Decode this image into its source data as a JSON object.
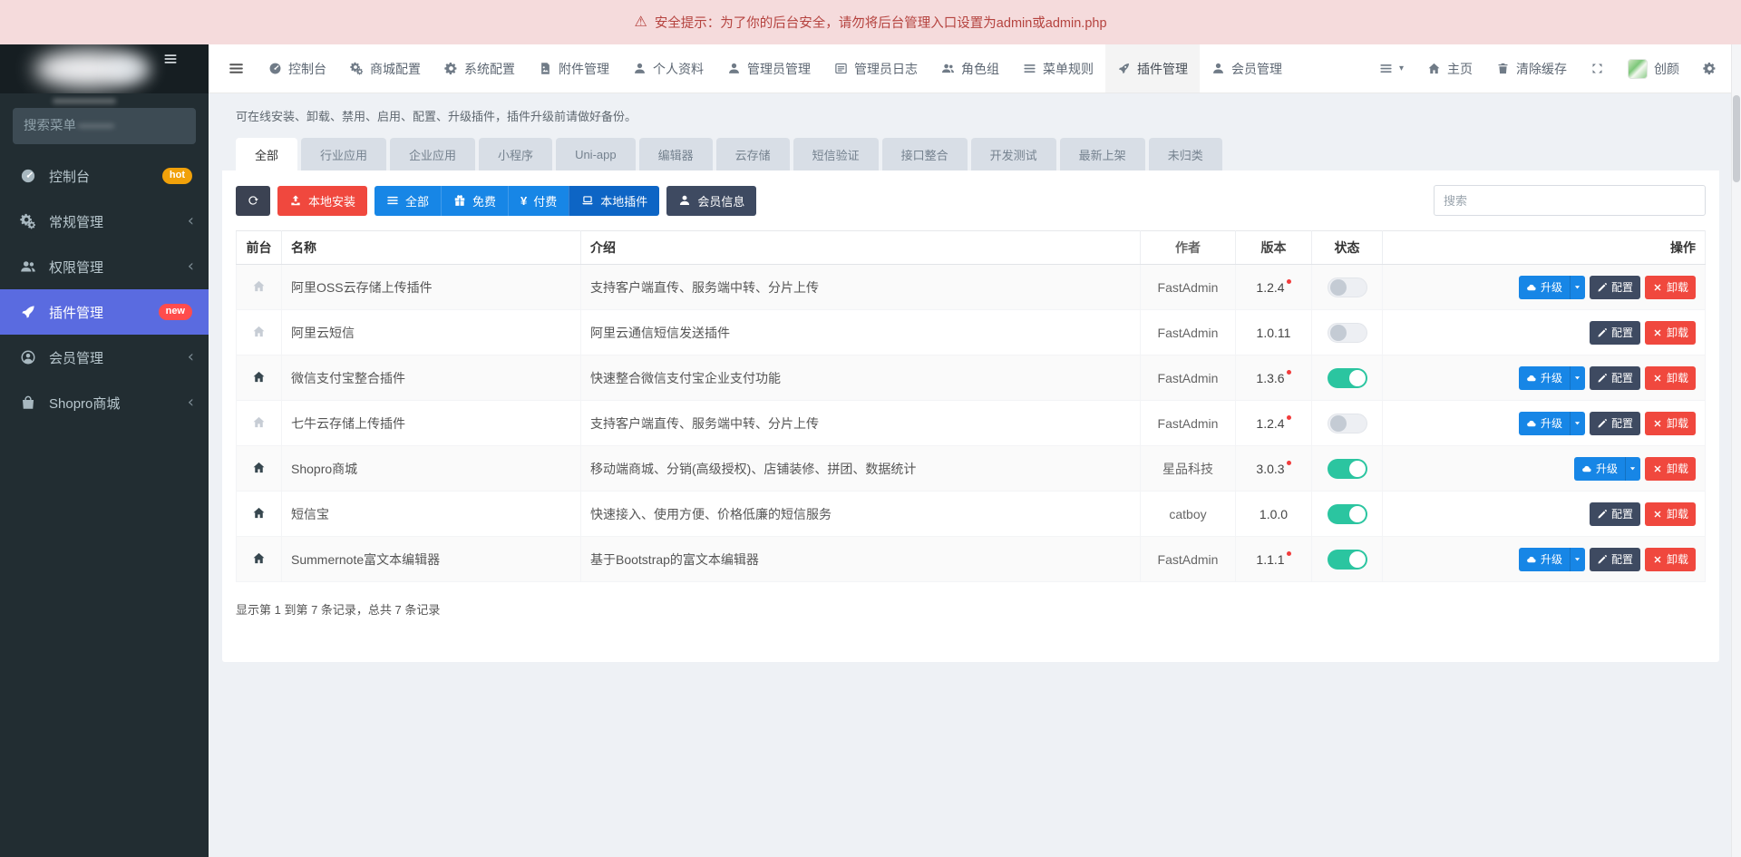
{
  "warning_bar": {
    "text": "安全提示：为了你的后台安全，请勿将后台管理入口设置为admin或admin.php"
  },
  "topnav": {
    "items": [
      {
        "key": "dashboard",
        "label": "控制台",
        "icon": "gauge-icon"
      },
      {
        "key": "shop-config",
        "label": "商城配置",
        "icon": "cogs-icon"
      },
      {
        "key": "system-config",
        "label": "系统配置",
        "icon": "gear-icon"
      },
      {
        "key": "attachment",
        "label": "附件管理",
        "icon": "file-image-icon"
      },
      {
        "key": "profile",
        "label": "个人资料",
        "icon": "user-icon"
      },
      {
        "key": "admin",
        "label": "管理员管理",
        "icon": "user-icon"
      },
      {
        "key": "admin-log",
        "label": "管理员日志",
        "icon": "log-icon"
      },
      {
        "key": "group",
        "label": "角色组",
        "icon": "users-icon"
      },
      {
        "key": "menu-rule",
        "label": "菜单规则",
        "icon": "list-icon"
      },
      {
        "key": "addon",
        "label": "插件管理",
        "icon": "rocket-icon",
        "active": true
      },
      {
        "key": "user",
        "label": "会员管理",
        "icon": "user-icon"
      }
    ],
    "home_label": "主页",
    "clear_cache_label": "清除缓存",
    "username": "创颜"
  },
  "sidebar": {
    "search_placeholder": "搜索菜单",
    "items": [
      {
        "key": "dashboard",
        "label": "控制台",
        "icon": "gauge-icon",
        "badge": "hot"
      },
      {
        "key": "general",
        "label": "常规管理",
        "icon": "cogs-icon",
        "chevron": true
      },
      {
        "key": "auth",
        "label": "权限管理",
        "icon": "users-icon",
        "chevron": true
      },
      {
        "key": "addon",
        "label": "插件管理",
        "icon": "rocket-icon",
        "badge": "new",
        "active": true
      },
      {
        "key": "user",
        "label": "会员管理",
        "icon": "user-circle-icon",
        "chevron": true
      },
      {
        "key": "shopro",
        "label": "Shopro商城",
        "icon": "shop-icon",
        "chevron": true
      }
    ]
  },
  "page": {
    "description": "可在线安装、卸载、禁用、启用、配置、升级插件，插件升级前请做好备份。",
    "tabs": [
      {
        "key": "all",
        "label": "全部",
        "active": true
      },
      {
        "key": "industry",
        "label": "行业应用"
      },
      {
        "key": "enterprise",
        "label": "企业应用"
      },
      {
        "key": "miniapp",
        "label": "小程序"
      },
      {
        "key": "uniapp",
        "label": "Uni-app"
      },
      {
        "key": "editor",
        "label": "编辑器"
      },
      {
        "key": "cloud-storage",
        "label": "云存储"
      },
      {
        "key": "sms",
        "label": "短信验证"
      },
      {
        "key": "api",
        "label": "接口整合"
      },
      {
        "key": "devtest",
        "label": "开发测试"
      },
      {
        "key": "newest",
        "label": "最新上架"
      },
      {
        "key": "uncategorized",
        "label": "未归类"
      }
    ],
    "toolbar": {
      "install": "本地安装",
      "all": "全部",
      "free": "免费",
      "paid": "付费",
      "paid_symbol": "¥",
      "local": "本地插件",
      "member": "会员信息",
      "search_placeholder": "搜索"
    },
    "table": {
      "columns": [
        "前台",
        "名称",
        "介绍",
        "作者",
        "版本",
        "状态",
        "操作"
      ],
      "action_labels": {
        "upgrade": "升级",
        "config": "配置",
        "uninstall": "卸载"
      },
      "rows": [
        {
          "front_active": false,
          "name": "阿里OSS云存储上传插件",
          "intro": "支持客户端直传、服务端中转、分片上传",
          "author": "FastAdmin",
          "version": "1.2.4",
          "update_dot": true,
          "status_on": false,
          "can_upgrade": true,
          "can_config": true
        },
        {
          "front_active": false,
          "name": "阿里云短信",
          "intro": "阿里云通信短信发送插件",
          "author": "FastAdmin",
          "version": "1.0.11",
          "update_dot": false,
          "status_on": false,
          "can_upgrade": false,
          "can_config": true
        },
        {
          "front_active": true,
          "name": "微信支付宝整合插件",
          "intro": "快速整合微信支付宝企业支付功能",
          "author": "FastAdmin",
          "version": "1.3.6",
          "update_dot": true,
          "status_on": true,
          "can_upgrade": true,
          "can_config": true
        },
        {
          "front_active": false,
          "name": "七牛云存储上传插件",
          "intro": "支持客户端直传、服务端中转、分片上传",
          "author": "FastAdmin",
          "version": "1.2.4",
          "update_dot": true,
          "status_on": false,
          "can_upgrade": true,
          "can_config": true
        },
        {
          "front_active": true,
          "name": "Shopro商城",
          "intro": "移动端商城、分销(高级授权)、店铺装修、拼团、数据统计",
          "author": "星品科技",
          "version": "3.0.3",
          "update_dot": true,
          "status_on": true,
          "can_upgrade": true,
          "can_config": false
        },
        {
          "front_active": true,
          "name": "短信宝",
          "intro": "快速接入、使用方便、价格低廉的短信服务",
          "author": "catboy",
          "version": "1.0.0",
          "update_dot": false,
          "status_on": true,
          "can_upgrade": false,
          "can_config": true
        },
        {
          "front_active": true,
          "name": "Summernote富文本编辑器",
          "intro": "基于Bootstrap的富文本编辑器",
          "author": "FastAdmin",
          "version": "1.1.1",
          "update_dot": true,
          "status_on": true,
          "can_upgrade": true,
          "can_config": true
        }
      ]
    },
    "footer": "显示第 1 到第 7 条记录，总共 7 条记录"
  },
  "colors": {
    "accent_blue": "#1786e6",
    "accent_blue_active": "#0d65c5",
    "danger_red": "#f0483e",
    "dark_slate": "#3e4a61",
    "toggle_on": "#2bc5a0",
    "sidebar_active": "#5a6be0",
    "hot_badge": "#f1a10a",
    "new_badge": "#ff4c4c",
    "warning_bg": "#f5dbdc",
    "warning_text": "#b5433f"
  }
}
